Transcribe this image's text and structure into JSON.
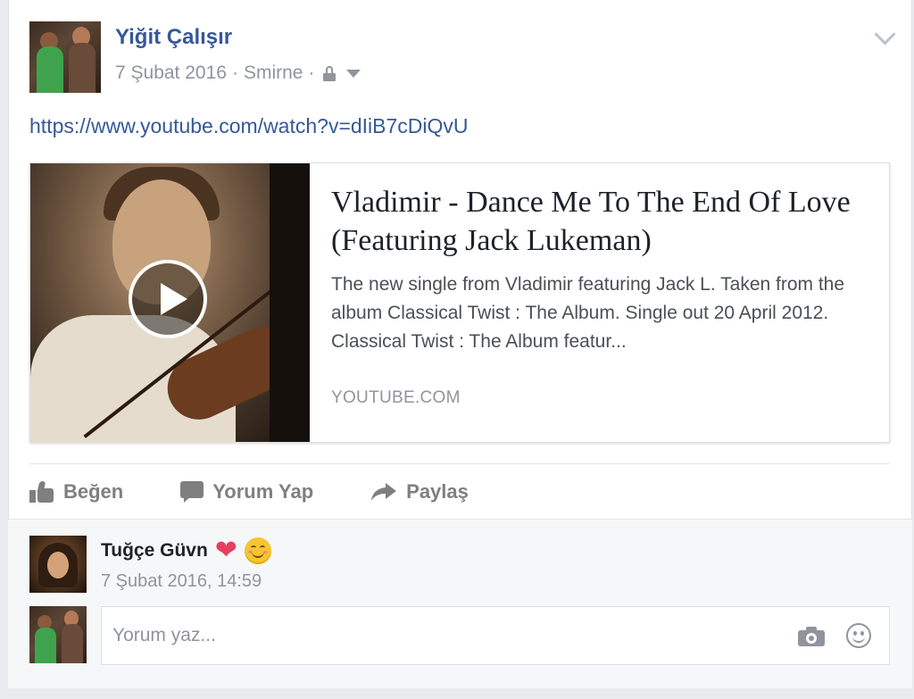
{
  "post": {
    "author": "Yiğit Çalışır",
    "date": "7 Şubat 2016",
    "separator1": "·",
    "location": "Smirne",
    "separator2": "·",
    "privacy_icon": "lock-icon",
    "audience_icon": "caret-down-icon",
    "options_icon": "chevron-down-icon",
    "link": "https://www.youtube.com/watch?v=dIiB7cDiQvU"
  },
  "share": {
    "title": "Vladimir - Dance Me To The End Of Love (Featuring Jack Lukeman)",
    "description": "The new single from Vladimir featuring Jack L. Taken from the album Classical Twist : The Album. Single out 20 April 2012. Classical Twist : The Album featur...",
    "domain": "YOUTUBE.COM",
    "play_icon": "play-icon"
  },
  "actions": {
    "like": "Beğen",
    "comment": "Yorum Yap",
    "share": "Paylaş"
  },
  "comment": {
    "author": "Tuğçe Güvn",
    "emojis": [
      "heart",
      "smiling-face-with-blush"
    ],
    "time": "7 Şubat 2016, 14:59"
  },
  "reply": {
    "placeholder": "Yorum yaz..."
  },
  "colors": {
    "link": "#365899",
    "meta": "#90949c",
    "action": "#7f7f7f",
    "heart": "#e5405e"
  }
}
